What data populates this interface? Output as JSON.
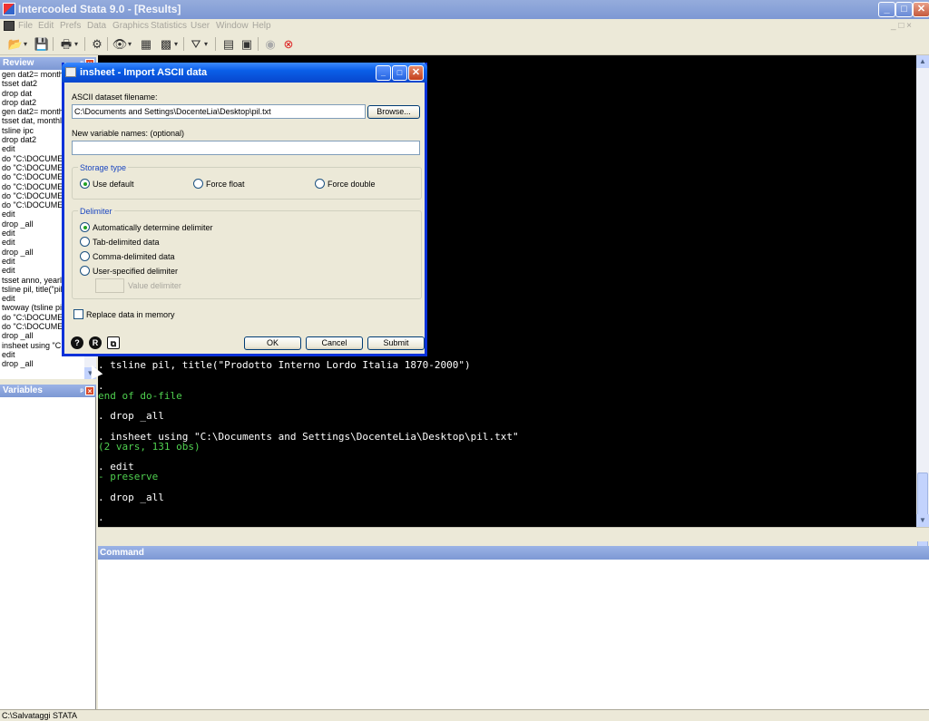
{
  "window": {
    "title": "Intercooled Stata 9.0 - [Results]",
    "min_glyph": "_",
    "max_glyph": "□",
    "close_glyph": "✕"
  },
  "menu": {
    "items": [
      "File",
      "Edit",
      "Prefs",
      "Data",
      "Graphics",
      "Statistics",
      "User",
      "Window",
      "Help"
    ],
    "right_controls": "_ □ ×"
  },
  "toolbar": {
    "icons": [
      "open-icon",
      "save-icon",
      "print-icon",
      "log-icon",
      "viewer-icon",
      "graph-icon",
      "dofile-icon",
      "filter-icon",
      "data-editor-icon",
      "data-browser-icon",
      "more-icon",
      "break-icon"
    ]
  },
  "review": {
    "title": "Review",
    "items": [
      "gen dat2= monthly",
      "tsset dat2",
      "drop dat",
      "drop dat2",
      "gen dat2= monthly",
      "tsset dat, monthly",
      "tsline ipc",
      "drop dat2",
      "edit",
      "do \"C:\\DOCUME",
      "do \"C:\\DOCUME",
      "do \"C:\\DOCUME",
      "do \"C:\\DOCUME",
      "do \"C:\\DOCUME",
      "do \"C:\\DOCUME",
      "edit",
      "drop _all",
      "edit",
      "edit",
      "drop _all",
      "edit",
      "edit",
      "tsset anno, yearly",
      "tsline pil, title(\"pil",
      "edit",
      "twoway (tsline pil",
      "do \"C:\\DOCUME",
      "do \"C:\\DOCUME",
      "drop _all",
      "insheet using \"C:\\",
      "edit",
      "drop _all"
    ]
  },
  "variables": {
    "title": "Variables"
  },
  "results": {
    "lines": [
      {
        "text": ". tsline pil, title(\"Prodotto Interno Lordo Italia 1870-2000\")",
        "color": "white"
      },
      {
        "text": ".",
        "color": "white"
      },
      {
        "text": "end of do-file",
        "color": "green"
      },
      {
        "text": ". drop _all",
        "color": "white"
      },
      {
        "text": ". insheet using \"C:\\Documents and Settings\\DocenteLia\\Desktop\\pil.txt\"",
        "color": "white"
      },
      {
        "text": "(2 vars, 131 obs)",
        "color": "green"
      },
      {
        "text": ". edit",
        "color": "white"
      },
      {
        "text": "- preserve",
        "color": "green"
      },
      {
        "text": ". drop _all",
        "color": "white"
      },
      {
        "text": ".",
        "color": "white"
      }
    ]
  },
  "command": {
    "title": "Command"
  },
  "status": {
    "path": "C:\\Salvataggi STATA"
  },
  "dialog": {
    "title": "insheet - Import ASCII data",
    "filename_label": "ASCII dataset filename:",
    "filename_value": "C:\\Documents and Settings\\DocenteLia\\Desktop\\pil.txt",
    "browse_label": "Browse...",
    "varnames_label": "New variable names: (optional)",
    "varnames_value": "",
    "storage_title": "Storage type",
    "storage_options": [
      "Use default",
      "Force float",
      "Force double"
    ],
    "storage_selected": 0,
    "delimiter_title": "Delimiter",
    "delimiter_options": [
      "Automatically determine delimiter",
      "Tab-delimited data",
      "Comma-delimited data",
      "User-specified delimiter"
    ],
    "delimiter_selected": 0,
    "value_delimiter_label": "Value delimiter",
    "replace_label": "Replace data in memory",
    "replace_checked": false,
    "ok_label": "OK",
    "cancel_label": "Cancel",
    "submit_label": "Submit",
    "help_glyph": "?",
    "reset_glyph": "R",
    "copy_glyph": "⧉",
    "min_glyph": "_",
    "max_glyph": "□",
    "close_glyph": "✕"
  },
  "colors": {
    "titlebar": "#7d98d4",
    "dialog_title": "#0a5fe8",
    "results_bg": "#000000",
    "results_text": "#ffffff",
    "results_green": "#4fcf4f",
    "panel_head": "#7d98d4"
  }
}
